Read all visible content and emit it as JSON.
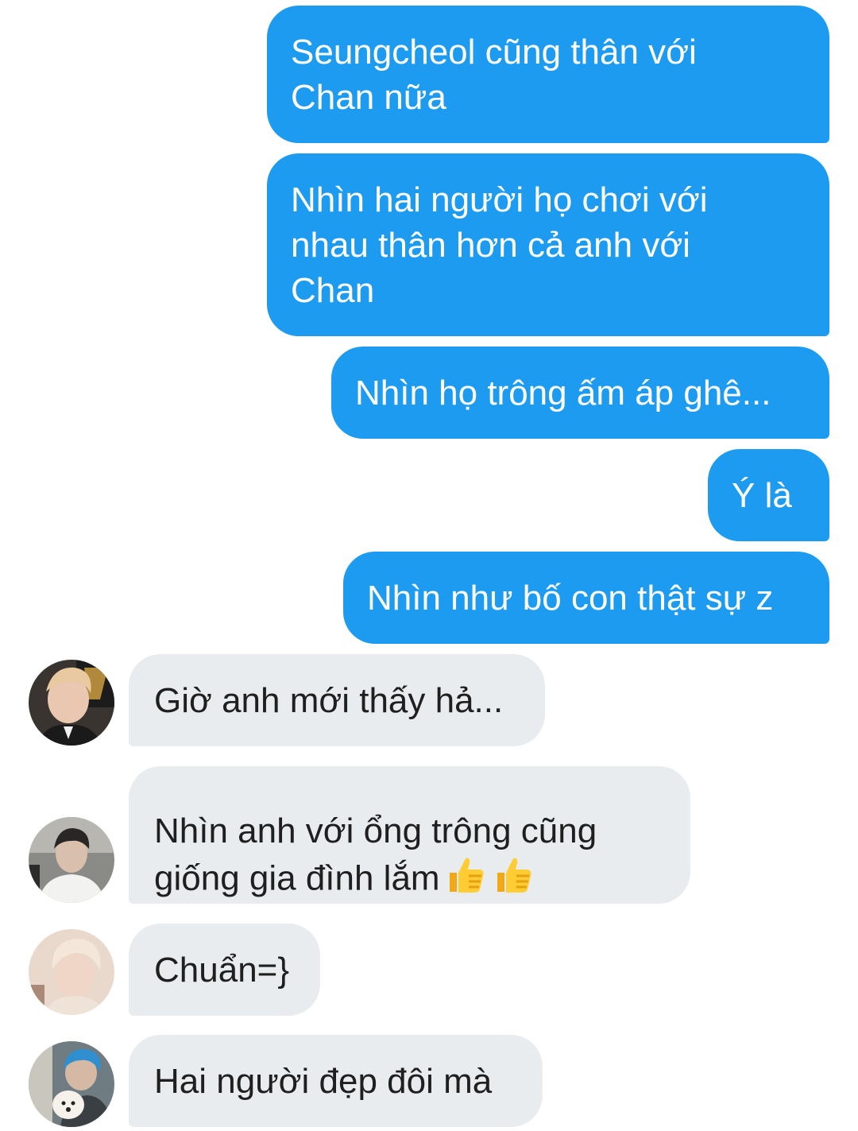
{
  "messages": {
    "sent": [
      {
        "text": "Seungcheol cũng thân với\nChan nữa"
      },
      {
        "text": "Nhìn hai người họ chơi với\nnhau thân hơn cả anh với\nChan"
      },
      {
        "text": "Nhìn họ trông ấm áp ghê..."
      },
      {
        "text": "Ý là"
      },
      {
        "text": "Nhìn như bố con thật sự z"
      }
    ],
    "received": [
      {
        "text": "Giờ anh mới thấy hả...",
        "avatar": "avatar-blond-suit"
      },
      {
        "text": "Nhìn anh với ổng trông cũng\ngiống gia đình lắm",
        "emoji": [
          "thumbs-up-icon",
          "thumbs-up-icon"
        ],
        "avatar": "avatar-white-shirt"
      },
      {
        "text": "Chuẩn=}",
        "avatar": "avatar-pastel-hair"
      },
      {
        "text": "Hai người đẹp đôi mà",
        "avatar": "avatar-blue-hair-dog"
      }
    ]
  },
  "colors": {
    "sent_bubble": "#1d9bf0",
    "received_bubble": "#e9ecef",
    "sent_text": "#ffffff",
    "received_text": "#1f1f1f"
  }
}
